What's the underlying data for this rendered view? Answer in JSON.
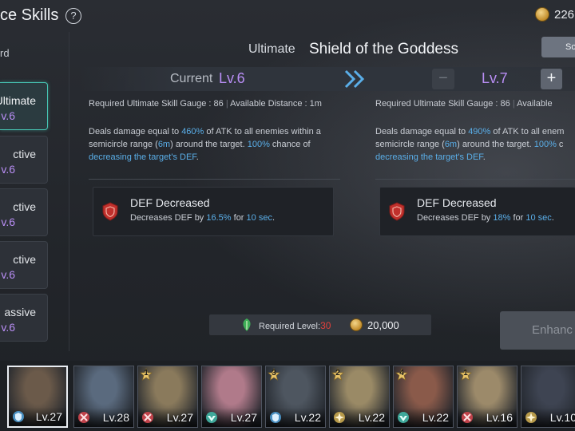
{
  "header": {
    "title": "ce Skills",
    "help": "?",
    "gold": "226"
  },
  "sidebar": {
    "label": "rd",
    "tabs": [
      {
        "type": "Ultimate",
        "level": "v.6",
        "active": true
      },
      {
        "type": "ctive",
        "level": "v.6"
      },
      {
        "type": "ctive",
        "level": "v.6"
      },
      {
        "type": "ctive",
        "level": "v.6"
      },
      {
        "type": "assive",
        "level": "v.6"
      }
    ]
  },
  "skill": {
    "type": "Ultimate",
    "name": "Shield of the Goddess",
    "side_button": "So",
    "current_label": "Current",
    "current_level": "Lv.6",
    "next_level": "Lv.7",
    "minus": "−",
    "plus": "+",
    "current": {
      "gauge_label": "Required Ultimate Skill Gauge : ",
      "gauge_value": "86",
      "distance_label": "Available Distance : ",
      "distance_value": "1m",
      "desc": {
        "a": "Deals damage equal to ",
        "atk": "460%",
        "b": " of ATK to all enemies within a",
        "c": "semicircle range (",
        "range": "6m",
        "d": ") around the target. ",
        "chance": "100%",
        "e": " chance of",
        "f": "decreasing the target's DEF",
        "g": "."
      },
      "effect": {
        "title": "DEF Decreased",
        "a": "Decreases DEF by ",
        "amount": "16.5%",
        "b": " for ",
        "duration": "10 sec",
        "c": "."
      }
    },
    "next": {
      "gauge_label": "Required Ultimate Skill Gauge : ",
      "gauge_value": "86",
      "distance_label": "Available ",
      "desc": {
        "a": "Deals damage equal to ",
        "atk": "490%",
        "b": " of ATK to all enem",
        "c": "semicircle range (",
        "range": "6m",
        "d": ") around the target. ",
        "chance": "100%",
        "e": " c",
        "f": "decreasing the target's DEF",
        "g": "."
      },
      "effect": {
        "title": "DEF Decreased",
        "a": "Decreases DEF by ",
        "amount": "18%",
        "b": " for ",
        "duration": "10 sec",
        "c": "."
      }
    }
  },
  "requirement": {
    "label": "Required Level:",
    "level": "30",
    "gold": "20,000"
  },
  "enhance_button": "Enhanc",
  "characters": [
    {
      "level": "Lv.27",
      "class_icon": "guardian-icon",
      "stars": "",
      "selected": true,
      "color": "#6b5a4a"
    },
    {
      "level": "Lv.28",
      "class_icon": "sword-icon",
      "stars": "",
      "color": "#5a6a7e"
    },
    {
      "level": "Lv.27",
      "class_icon": "sword-icon",
      "stars": "1",
      "color": "#8a7a5c"
    },
    {
      "level": "Lv.27",
      "class_icon": "healer-icon",
      "stars": "",
      "color": "#b07a8a"
    },
    {
      "level": "Lv.22",
      "class_icon": "guardian-icon",
      "stars": "3",
      "color": "#4e5660"
    },
    {
      "level": "Lv.22",
      "class_icon": "support-icon",
      "stars": "2",
      "color": "#9a8a66"
    },
    {
      "level": "Lv.22",
      "class_icon": "healer-icon",
      "stars": "4",
      "color": "#8a5a4a"
    },
    {
      "level": "Lv.16",
      "class_icon": "sword-icon",
      "stars": "1",
      "color": "#9c8a6a"
    },
    {
      "level": "Lv.10",
      "class_icon": "support-icon",
      "stars": "",
      "color": "#3e4452"
    }
  ],
  "colors": {
    "accent_teal": "#47c5b4",
    "level_purple": "#b98ef5",
    "highlight_blue": "#5aaee8",
    "required_red": "#e2403c"
  }
}
